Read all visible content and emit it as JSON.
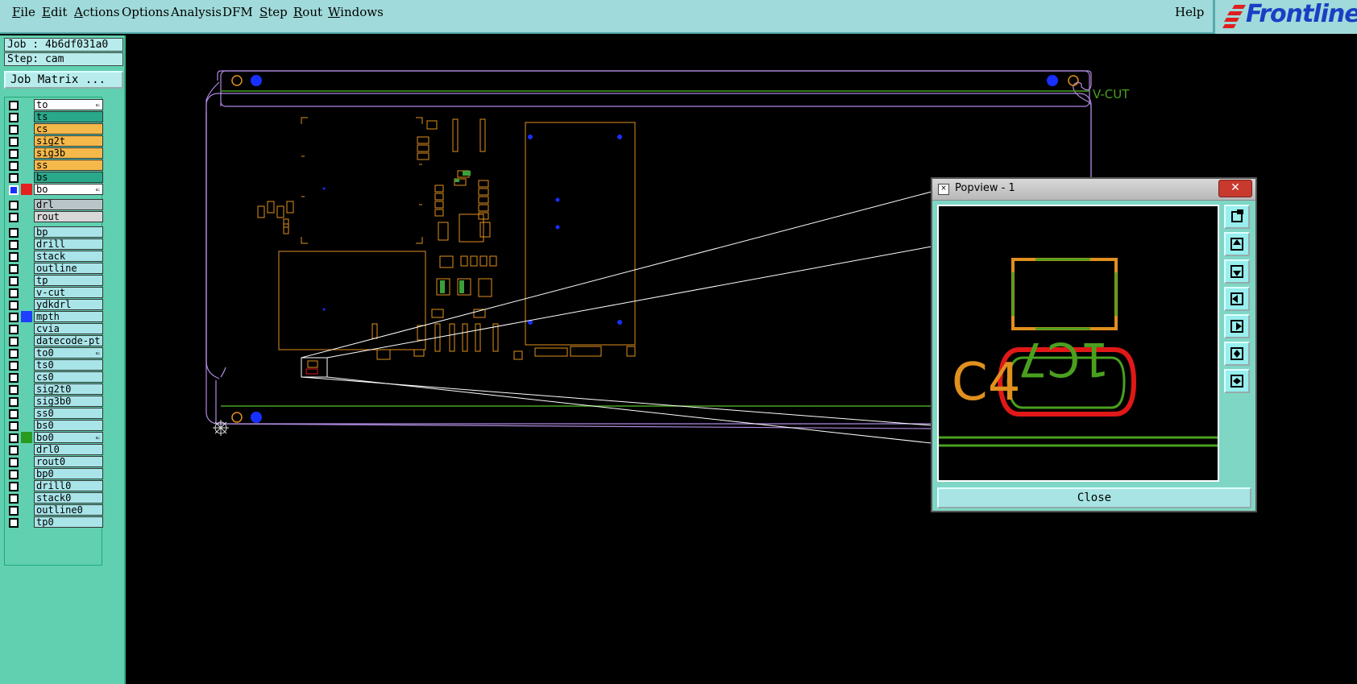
{
  "menubar": {
    "items": [
      {
        "label": "File",
        "underline": "F"
      },
      {
        "label": "Edit",
        "underline": "E"
      },
      {
        "label": "Actions",
        "underline": "A"
      },
      {
        "label": "Options",
        "underline": ""
      },
      {
        "label": "Analysis",
        "underline": ""
      },
      {
        "label": "DFM",
        "underline": ""
      },
      {
        "label": "Step",
        "underline": "S"
      },
      {
        "label": "Rout",
        "underline": "R"
      },
      {
        "label": "Windows",
        "underline": "W"
      }
    ],
    "help": "Help",
    "logo": "Frontline"
  },
  "left": {
    "job": "Job : 4b6df031a0",
    "step": "Step: cam",
    "job_matrix": "Job Matrix ..."
  },
  "layers": [
    {
      "name": "to",
      "bg": "#ffffff",
      "hook": true
    },
    {
      "name": "ts",
      "bg": "#2aa88a"
    },
    {
      "name": "cs",
      "bg": "#f5b84a"
    },
    {
      "name": "sig2t",
      "bg": "#f5b84a"
    },
    {
      "name": "sig3b",
      "bg": "#f5b84a"
    },
    {
      "name": "ss",
      "bg": "#f5b84a"
    },
    {
      "name": "bs",
      "bg": "#2aa88a"
    },
    {
      "name": "bo",
      "bg": "#ffffff",
      "hook": true,
      "swatch": "#e52020",
      "checked": true
    },
    {
      "name": "drl",
      "bg": "#b8c4c8",
      "gap": true
    },
    {
      "name": "rout",
      "bg": "#d8d8d8"
    },
    {
      "name": "bp",
      "bg": "#a8e4e8",
      "gap": true
    },
    {
      "name": "drill",
      "bg": "#a8e4e8"
    },
    {
      "name": "stack",
      "bg": "#a8e4e8"
    },
    {
      "name": "outline",
      "bg": "#a8e4e8"
    },
    {
      "name": "tp",
      "bg": "#a8e4e8"
    },
    {
      "name": "v-cut",
      "bg": "#a8e4e8"
    },
    {
      "name": "ydkdrl",
      "bg": "#a8e4e8"
    },
    {
      "name": "mpth",
      "bg": "#a8e4e8",
      "swatch": "#2040ff"
    },
    {
      "name": "cvia",
      "bg": "#a8e4e8"
    },
    {
      "name": "datecode-pt",
      "bg": "#a8e4e8"
    },
    {
      "name": "to0",
      "bg": "#a8e4e8",
      "hook": true
    },
    {
      "name": "ts0",
      "bg": "#a8e4e8"
    },
    {
      "name": "cs0",
      "bg": "#a8e4e8"
    },
    {
      "name": "sig2t0",
      "bg": "#a8e4e8"
    },
    {
      "name": "sig3b0",
      "bg": "#a8e4e8"
    },
    {
      "name": "ss0",
      "bg": "#a8e4e8"
    },
    {
      "name": "bs0",
      "bg": "#a8e4e8"
    },
    {
      "name": "bo0",
      "bg": "#a8e4e8",
      "hook": true,
      "swatch": "#2a9a20"
    },
    {
      "name": "drl0",
      "bg": "#a8e4e8"
    },
    {
      "name": "rout0",
      "bg": "#a8e4e8"
    },
    {
      "name": "bp0",
      "bg": "#a8e4e8"
    },
    {
      "name": "drill0",
      "bg": "#a8e4e8"
    },
    {
      "name": "stack0",
      "bg": "#a8e4e8"
    },
    {
      "name": "outline0",
      "bg": "#a8e4e8"
    },
    {
      "name": "tp0",
      "bg": "#a8e4e8"
    }
  ],
  "canvas": {
    "vcut_label": "V-CUT"
  },
  "popview": {
    "title": "Popview - 1",
    "close_x": "✕",
    "close_button": "Close",
    "silk_text_1": "C4",
    "silk_text_2": "1C7"
  },
  "colors": {
    "menubar_bg": "#a0dada",
    "panel_bg": "#60d0b0",
    "outline": "#b08ae0",
    "silk_orange": "#e0901e",
    "green": "#4aa01e",
    "red": "#e01818",
    "pad_blue": "#1830ff"
  }
}
